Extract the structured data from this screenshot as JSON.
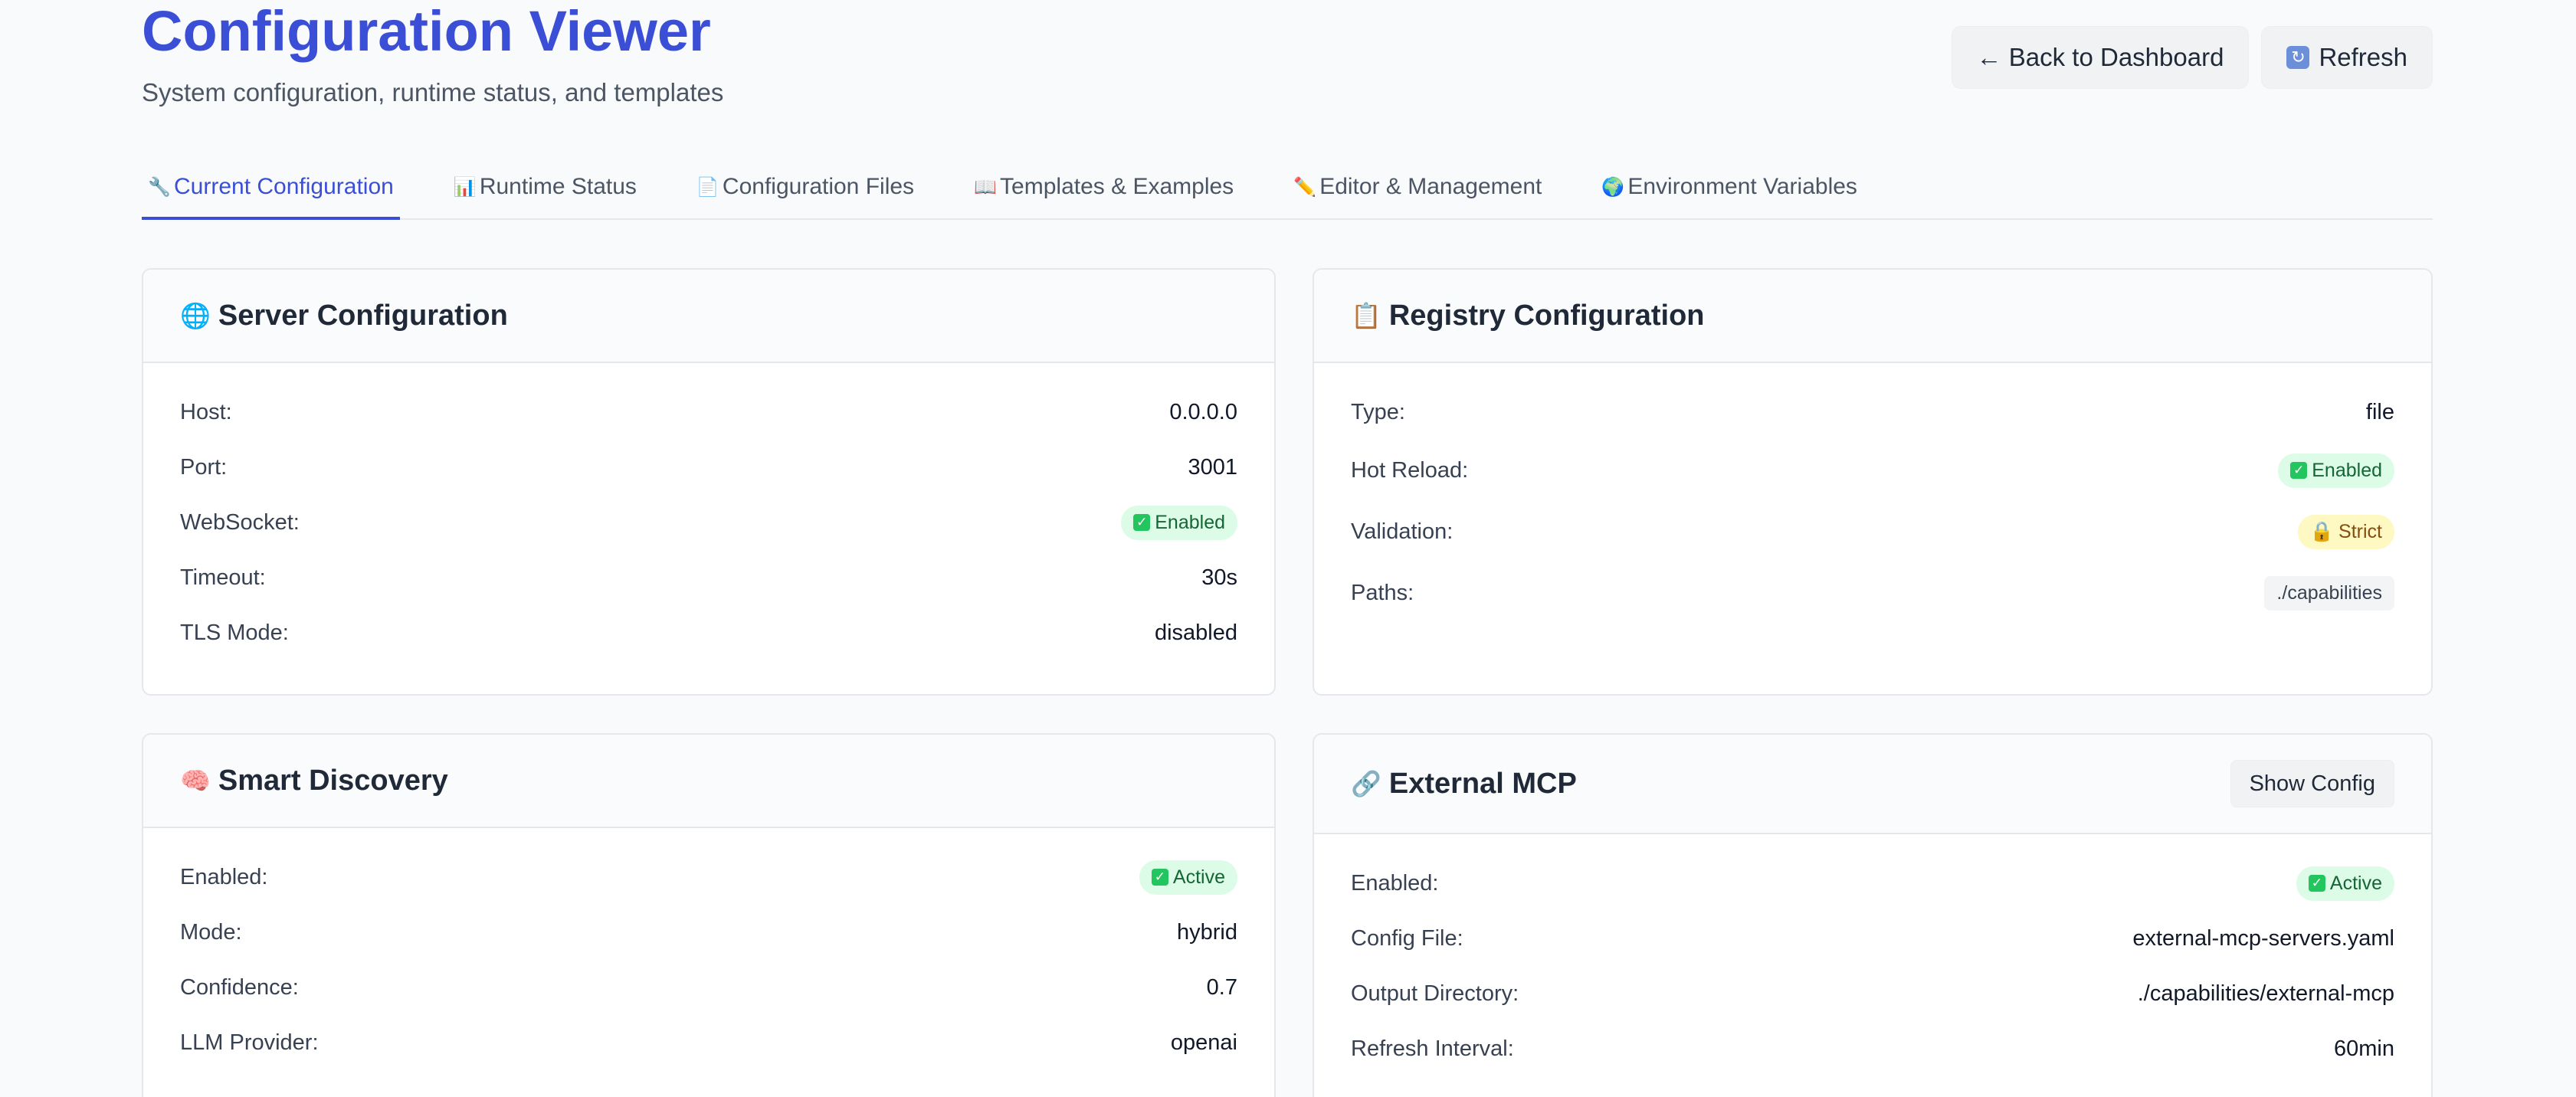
{
  "header": {
    "title": "Configuration Viewer",
    "subtitle": "System configuration, runtime status, and templates",
    "back_label": "← Back to Dashboard",
    "refresh_label": "Refresh"
  },
  "tabs": [
    {
      "icon": "🔧",
      "label": "Current Configuration",
      "active": true
    },
    {
      "icon": "📊",
      "label": "Runtime Status"
    },
    {
      "icon": "📄",
      "label": "Configuration Files"
    },
    {
      "icon": "📖",
      "label": "Templates & Examples"
    },
    {
      "icon": "✏️",
      "label": "Editor & Management"
    },
    {
      "icon": "🌍",
      "label": "Environment Variables"
    }
  ],
  "server": {
    "icon": "🌐",
    "title": "Server Configuration",
    "rows": [
      {
        "label": "Host:",
        "value": "0.0.0.0"
      },
      {
        "label": "Port:",
        "value": "3001"
      },
      {
        "label": "WebSocket:",
        "value": "Enabled"
      },
      {
        "label": "Timeout:",
        "value": "30s"
      },
      {
        "label": "TLS Mode:",
        "value": "disabled"
      }
    ]
  },
  "registry": {
    "icon": "📋",
    "title": "Registry Configuration",
    "rows": [
      {
        "label": "Type:",
        "value": "file"
      },
      {
        "label": "Hot Reload:",
        "value": "Enabled"
      },
      {
        "label": "Validation:",
        "value": "Strict"
      },
      {
        "label": "Paths:",
        "value": "./capabilities"
      }
    ]
  },
  "discovery": {
    "icon": "🧠",
    "title": "Smart Discovery",
    "rows": [
      {
        "label": "Enabled:",
        "value": "Active"
      },
      {
        "label": "Mode:",
        "value": "hybrid"
      },
      {
        "label": "Confidence:",
        "value": "0.7"
      },
      {
        "label": "LLM Provider:",
        "value": "openai"
      }
    ]
  },
  "external": {
    "icon": "🔗",
    "title": "External MCP",
    "show_config_label": "Show Config",
    "rows": [
      {
        "label": "Enabled:",
        "value": "Active"
      },
      {
        "label": "Config File:",
        "value": "external-mcp-servers.yaml"
      },
      {
        "label": "Output Directory:",
        "value": "./capabilities/external-mcp"
      },
      {
        "label": "Refresh Interval:",
        "value": "60min"
      }
    ]
  }
}
